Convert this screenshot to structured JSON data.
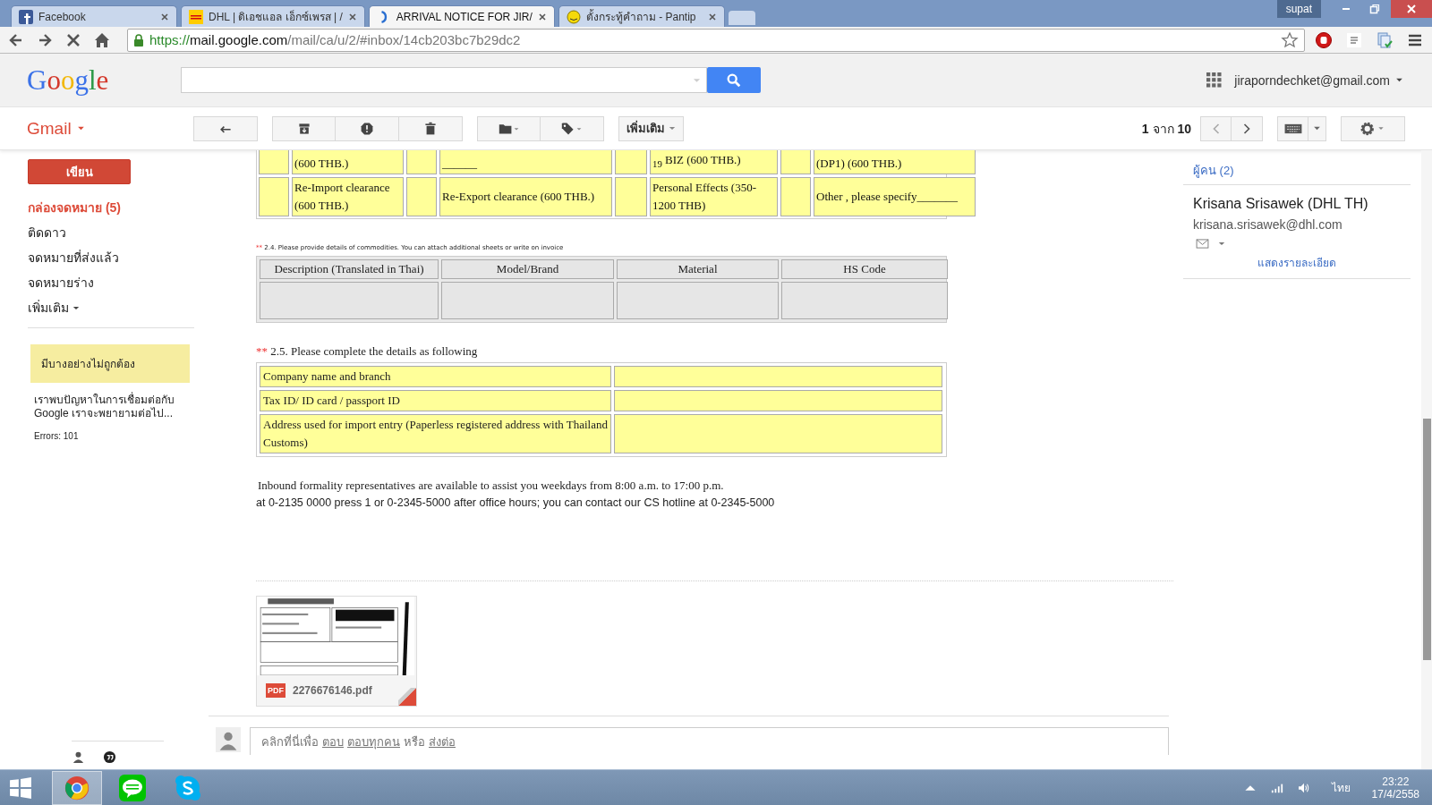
{
  "browser": {
    "tabs": [
      {
        "title": "Facebook",
        "selected": false
      },
      {
        "title": "DHL | ดิเอชแอล เอ็กซ์เพรส | /",
        "selected": false
      },
      {
        "title": "ARRIVAL NOTICE FOR JIR/",
        "selected": true
      },
      {
        "title": "ตั้งกระทู้คำถาม - Pantip",
        "selected": false
      }
    ],
    "user": "supat",
    "url": {
      "scheme": "https://",
      "host": "mail.google.com",
      "path": "/mail/ca/u/2/#inbox/14cb203bc7b29dc2"
    }
  },
  "header": {
    "logo": "Google",
    "account": "jiraporndechket@gmail.com"
  },
  "toolbar": {
    "app_menu": "Gmail",
    "more": "เพิ่มเติม",
    "pager": "**1** จาก **10**"
  },
  "sidebar": {
    "compose": "เขียน",
    "items": [
      {
        "label": "กล่องจดหมาย (5)",
        "selected": true
      },
      {
        "label": "ติดดาว",
        "selected": false
      },
      {
        "label": "จดหมายที่ส่งแล้ว",
        "selected": false
      },
      {
        "label": "จดหมายร่าง",
        "selected": false
      }
    ],
    "more": "เพิ่มเติม",
    "notice": {
      "title": "มีบางอย่างไม่ถูกต้อง",
      "message": "เราพบปัญหาในการเชื่อมต่อกับ Google เราจะพยายามต่อไป...",
      "errors": "Errors: 101"
    }
  },
  "email": {
    "clearance_rows": [
      [
        "(600 THB.)",
        "______",
        "$_{19}$ BIZ (600 THB.)",
        "(DP1) (600 THB.)"
      ],
      [
        "Re-Import clearance (600 THB.)",
        "Re-Export clearance (600 THB.)",
        "Personal Effects (350-1200 THB)",
        "Other , please specify_______"
      ]
    ],
    "commodities": {
      "marker": "**",
      "note": "2.4. Please provide details of commodities. You can attach additional sheets or write on invoice",
      "columns": [
        "Description (Translated in Thai)",
        "Model/Brand",
        "Material",
        "HS Code"
      ]
    },
    "details": {
      "marker": "**",
      "heading": "2.5. Please complete the details as following",
      "rows": [
        "Company name and branch",
        "Tax ID/ ID card / passport ID",
        "Address used for import entry (Paperless registered address with Thailand Customs)"
      ]
    },
    "contact": [
      "Inbound formality representatives are available to assist you weekdays from 8:00 a.m. to 17:00 p.m.",
      "at 0-2135 0000 press 1 or 0-2345-5000 after office hours; you can contact our CS hotline at 0-2345-5000"
    ],
    "attachment": {
      "badge": "PDF",
      "filename": "2276676146.pdf"
    },
    "reply": {
      "prefix": "คลิกที่นี่เพื่อ",
      "reply": "ตอบ",
      "reply_all": "ตอบทุกคน",
      "or": "หรือ",
      "forward": "ส่งต่อ"
    }
  },
  "people": {
    "heading": "ผู้คน (2)",
    "name": "Krisana Srisawek (DHL TH)",
    "email": "krisana.srisawek@dhl.com",
    "details": "แสดงรายละเอียด"
  },
  "taskbar": {
    "language": "ไทย",
    "time": "23:22",
    "date": "17/4/2558"
  }
}
